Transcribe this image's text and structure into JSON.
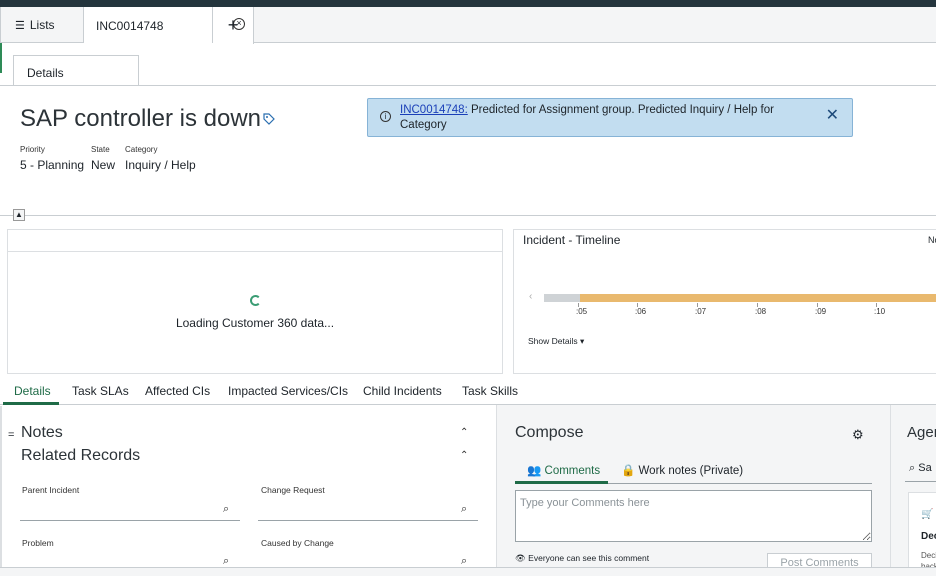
{
  "tabs": {
    "lists_label": "Lists",
    "record_label": "INC0014748",
    "add_label": "+"
  },
  "sub_tab": {
    "label": "Details"
  },
  "record": {
    "title": "SAP controller is down",
    "priority_label": "Priority",
    "priority_value": "5 - Planning",
    "state_label": "State",
    "state_value": "New",
    "category_label": "Category",
    "category_value": "Inquiry / Help"
  },
  "alert": {
    "link": "INC0014748:",
    "text": " Predicted for Assignment group. Predicted Inquiry / Help for Category"
  },
  "customer360": {
    "loading_text": "Loading Customer 360 data..."
  },
  "timeline": {
    "title": "Incident - Timeline",
    "right_label": "No",
    "ticks": [
      ":05",
      ":06",
      ":07",
      ":08",
      ":09",
      ":10"
    ],
    "show_details": "Show Details"
  },
  "detail_tabs": [
    {
      "label": "Details"
    },
    {
      "label": "Task SLAs"
    },
    {
      "label": "Affected CIs"
    },
    {
      "label": "Impacted Services/CIs"
    },
    {
      "label": "Child Incidents"
    },
    {
      "label": "Task Skills"
    }
  ],
  "notes": {
    "heading": "Notes"
  },
  "related": {
    "heading": "Related Records",
    "parent_incident_label": "Parent Incident",
    "change_request_label": "Change Request",
    "problem_label": "Problem",
    "caused_by_change_label": "Caused by Change"
  },
  "compose": {
    "heading": "Compose",
    "comments_tab": "Comments",
    "work_notes_tab": "Work notes (Private)",
    "placeholder": "Type your Comments here",
    "visibility_text": "Everyone can see this comment",
    "post_button": "Post Comments"
  },
  "agent": {
    "heading": "Agent",
    "search_placeholder": "Sa",
    "card_title": "Dec",
    "card_line1": "Deci",
    "card_line2": "back"
  },
  "colors": {
    "accent_green": "#1f6b47",
    "alert_bg": "#c2ddf0",
    "timeline_bar": "#e9b96e",
    "topbar": "#24353d"
  }
}
